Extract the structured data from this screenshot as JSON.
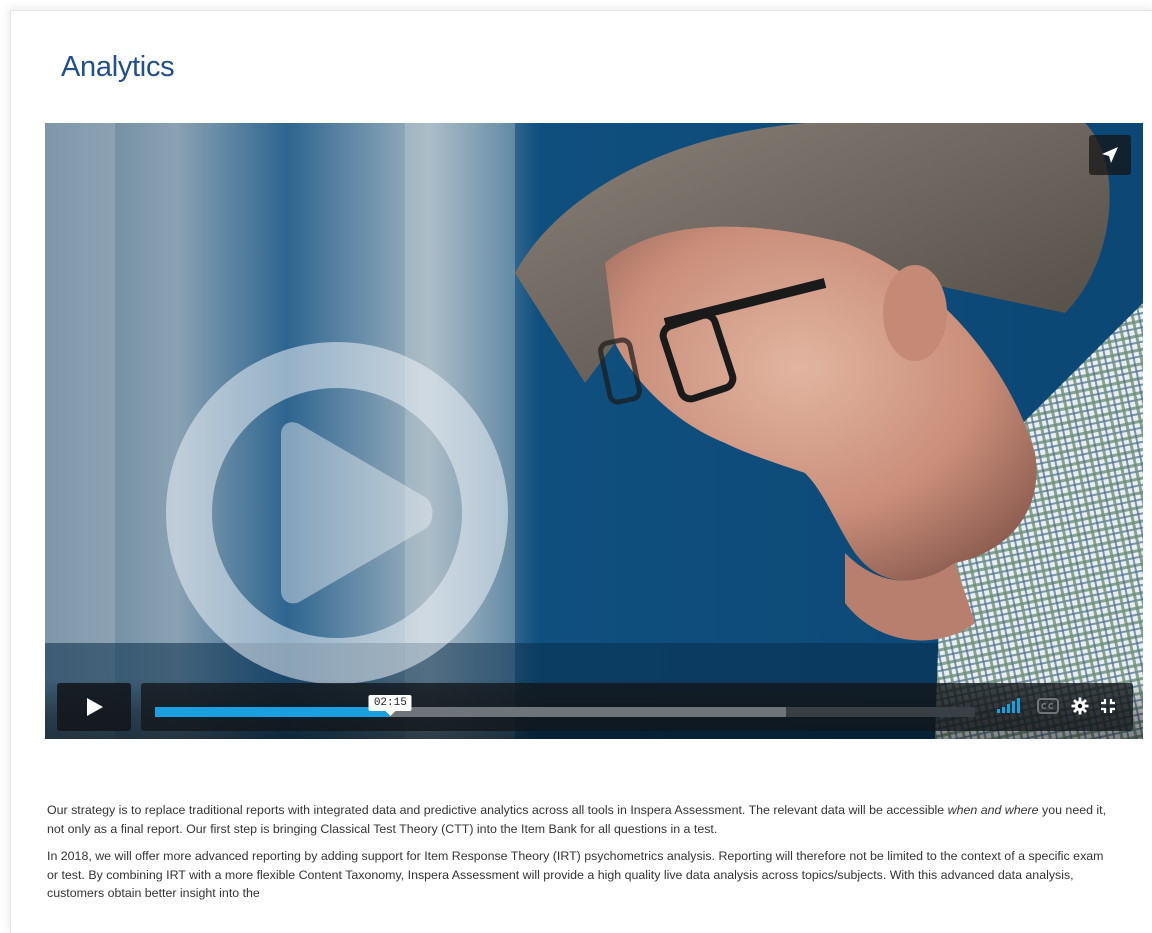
{
  "page": {
    "title": "Analytics"
  },
  "video": {
    "current_time": "02:15",
    "played_fraction": 0.287,
    "loaded_fraction": 0.769,
    "volume_level": 1.0,
    "icons": {
      "big_play": "play-circle-icon",
      "share": "paper-plane-icon",
      "play": "play-icon",
      "volume": "volume-bars-icon",
      "captions": "closed-captions-icon",
      "settings": "gear-icon",
      "fullscreen": "fullscreen-icon"
    },
    "colors": {
      "progress": "#1aa0e0",
      "volume": "#1aa0e0",
      "control_bg": "#12161a"
    }
  },
  "content": {
    "p1_before": "Our strategy is to replace traditional reports with integrated data and predictive analytics across all tools in Inspera Assessment. The relevant data will be accessible ",
    "p1_em": "when and where",
    "p1_after": " you need it, not only as a final report.  Our first step is bringing Classical Test Theory (CTT) into the Item Bank for all questions in a test.",
    "p2": "In 2018, we will offer more advanced reporting by adding support for Item Response Theory (IRT) psychometrics analysis. Reporting will therefore not be limited to the context of a specific exam or test. By combining IRT with a more flexible Content Taxonomy, Inspera Assessment will provide a high quality live data analysis across topics/subjects. With this advanced data analysis, customers obtain better insight into the"
  }
}
